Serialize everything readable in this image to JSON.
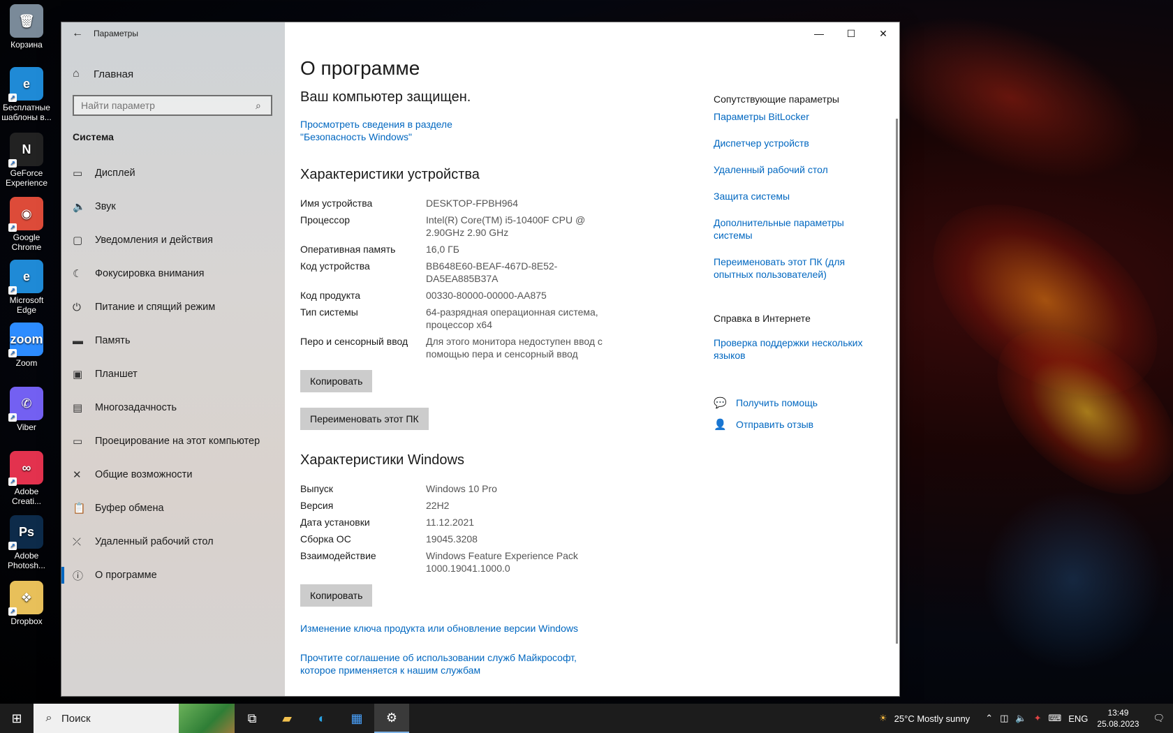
{
  "desktop": {
    "icons": [
      {
        "label": "Корзина",
        "icon": "recycle-bin-icon",
        "color": "#7a8a99",
        "glyph": "🗑"
      },
      {
        "label": "Бесплатные шаблоны в...",
        "icon": "edge-icon",
        "color": "#1f8ad6",
        "glyph": "e"
      },
      {
        "label": "GeForce Experience",
        "icon": "geforce-icon",
        "color": "#222222",
        "glyph": "N"
      },
      {
        "label": "Google Chrome",
        "icon": "chrome-icon",
        "color": "#dd4b39",
        "glyph": "◉"
      },
      {
        "label": "Microsoft Edge",
        "icon": "edge-icon",
        "color": "#1f8ad6",
        "glyph": "e"
      },
      {
        "label": "Zoom",
        "icon": "zoom-icon",
        "color": "#2d8cff",
        "glyph": "zoom"
      },
      {
        "label": "Viber",
        "icon": "viber-icon",
        "color": "#7360f2",
        "glyph": "✆"
      },
      {
        "label": "Adobe Creati...",
        "icon": "adobe-cc-icon",
        "color": "#e3324e",
        "glyph": "∞"
      },
      {
        "label": "Adobe Photosh...",
        "icon": "photoshop-icon",
        "color": "#0d2b4a",
        "glyph": "Ps"
      },
      {
        "label": "Dropbox",
        "icon": "dropbox-icon",
        "color": "#e8c05a",
        "glyph": "❖"
      }
    ]
  },
  "window": {
    "app_title": "Параметры",
    "minimize": "—",
    "maximize": "☐",
    "close": "✕"
  },
  "nav": {
    "home": "Главная",
    "search_placeholder": "Найти параметр",
    "section": "Система",
    "items": [
      {
        "label": "Дисплей",
        "icon": "display-icon",
        "glyph": "▭"
      },
      {
        "label": "Звук",
        "icon": "sound-icon",
        "glyph": "🔈"
      },
      {
        "label": "Уведомления и действия",
        "icon": "notifications-icon",
        "glyph": "▢"
      },
      {
        "label": "Фокусировка внимания",
        "icon": "focus-assist-icon",
        "glyph": "☾"
      },
      {
        "label": "Питание и спящий режим",
        "icon": "power-icon",
        "glyph": "⏻"
      },
      {
        "label": "Память",
        "icon": "storage-icon",
        "glyph": "▬"
      },
      {
        "label": "Планшет",
        "icon": "tablet-icon",
        "glyph": "▣"
      },
      {
        "label": "Многозадачность",
        "icon": "multitasking-icon",
        "glyph": "▤"
      },
      {
        "label": "Проецирование на этот компьютер",
        "icon": "projecting-icon",
        "glyph": "▭"
      },
      {
        "label": "Общие возможности",
        "icon": "shared-experiences-icon",
        "glyph": "✕"
      },
      {
        "label": "Буфер обмена",
        "icon": "clipboard-icon",
        "glyph": "📋"
      },
      {
        "label": "Удаленный рабочий стол",
        "icon": "remote-desktop-icon",
        "glyph": "⤫"
      },
      {
        "label": "О программе",
        "icon": "about-icon",
        "glyph": "ⓘ"
      }
    ]
  },
  "main": {
    "title": "О программе",
    "protected": "Ваш компьютер защищен.",
    "security_link": "Просмотреть сведения в разделе \"Безопасность Windows\"",
    "device_header": "Характеристики устройства",
    "device_specs": [
      {
        "k": "Имя устройства",
        "v": "DESKTOP-FPBH964"
      },
      {
        "k": "Процессор",
        "v": "Intel(R) Core(TM) i5-10400F CPU @ 2.90GHz   2.90 GHz"
      },
      {
        "k": "Оперативная память",
        "v": "16,0 ГБ"
      },
      {
        "k": "Код устройства",
        "v": "BB648E60-BEAF-467D-8E52-DA5EA885B37A"
      },
      {
        "k": "Код продукта",
        "v": "00330-80000-00000-AA875"
      },
      {
        "k": "Тип системы",
        "v": "64-разрядная операционная система, процессор x64"
      },
      {
        "k": "Перо и сенсорный ввод",
        "v": "Для этого монитора недоступен ввод с помощью пера и сенсорный ввод"
      }
    ],
    "copy_label": "Копировать",
    "rename_label": "Переименовать этот ПК",
    "windows_header": "Характеристики Windows",
    "windows_specs": [
      {
        "k": "Выпуск",
        "v": "Windows 10 Pro"
      },
      {
        "k": "Версия",
        "v": "22H2"
      },
      {
        "k": "Дата установки",
        "v": "11.12.2021"
      },
      {
        "k": "Сборка ОС",
        "v": "19045.3208"
      },
      {
        "k": "Взаимодействие",
        "v": "Windows Feature Experience Pack 1000.19041.1000.0"
      }
    ],
    "copy_label2": "Копировать",
    "change_key_link": "Изменение ключа продукта или обновление версии Windows",
    "agreement_link": "Прочтите соглашение об использовании служб Майкрософт, которое применяется к нашим службам"
  },
  "side": {
    "related_header": "Сопутствующие параметры",
    "related_links": [
      "Параметры BitLocker",
      "Диспетчер устройств",
      "Удаленный рабочий стол",
      "Защита системы",
      "Дополнительные параметры системы",
      "Переименовать этот ПК (для опытных пользователей)"
    ],
    "web_header": "Справка в Интернете",
    "web_links": [
      "Проверка поддержки нескольких языков"
    ],
    "get_help": "Получить помощь",
    "feedback": "Отправить отзыв"
  },
  "taskbar": {
    "search_text": "Поиск",
    "weather": "25°C  Mostly sunny",
    "lang": "ENG",
    "time": "13:49",
    "date": "25.08.2023"
  },
  "colors": {
    "accent": "#0067c0",
    "link": "#0067c0"
  }
}
